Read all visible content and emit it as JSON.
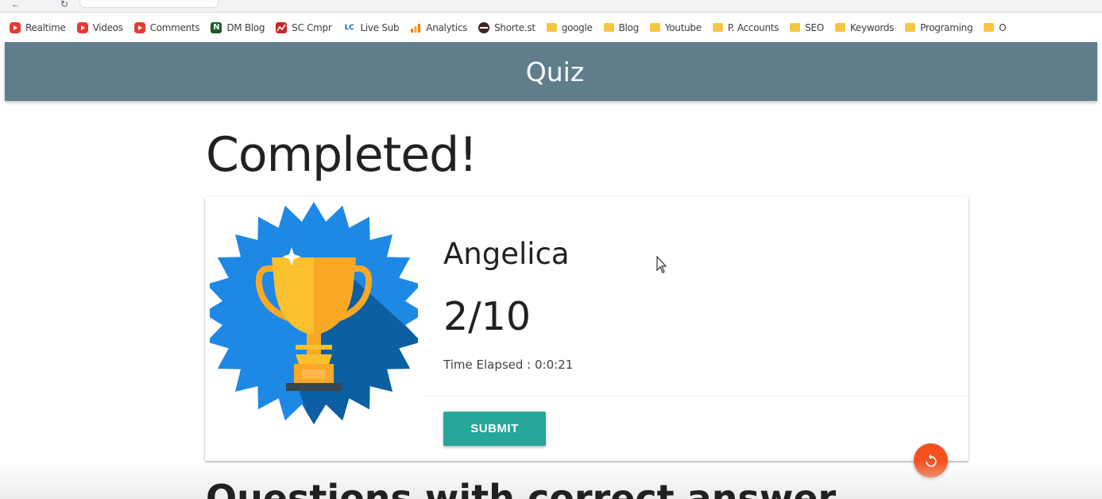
{
  "bookmarks": [
    {
      "label": "Realtime",
      "icon": "youtube-icon"
    },
    {
      "label": "Videos",
      "icon": "youtube-icon"
    },
    {
      "label": "Comments",
      "icon": "youtube-icon"
    },
    {
      "label": "DM Blog",
      "icon": "dm-blog-icon",
      "glyph": "N"
    },
    {
      "label": "SC Cmpr",
      "icon": "sc-icon"
    },
    {
      "label": "Live Sub",
      "icon": "lc-icon",
      "glyph": "LC"
    },
    {
      "label": "Analytics",
      "icon": "analytics-icon"
    },
    {
      "label": "Shorte.st",
      "icon": "shortest-icon"
    },
    {
      "label": "google",
      "icon": "folder-icon"
    },
    {
      "label": "Blog",
      "icon": "folder-icon"
    },
    {
      "label": "Youtube",
      "icon": "folder-icon"
    },
    {
      "label": "P. Accounts",
      "icon": "folder-icon"
    },
    {
      "label": "SEO",
      "icon": "folder-icon"
    },
    {
      "label": "Keywords",
      "icon": "folder-icon"
    },
    {
      "label": "Programing",
      "icon": "folder-icon"
    },
    {
      "label": "O",
      "icon": "folder-icon"
    }
  ],
  "header": {
    "title": "Quiz"
  },
  "result": {
    "heading": "Completed!",
    "name": "Angelica",
    "score": "2/10",
    "time_elapsed": "Time Elapsed : 0:0:21",
    "submit_label": "SUBMIT"
  },
  "next_section": {
    "heading": "Questions with correct answer"
  },
  "colors": {
    "header_bg": "#607d8b",
    "submit_bg": "#26a69a",
    "fab_bg": "#f4511e",
    "badge_light": "#1e88e5",
    "badge_dark": "#0d5fa3",
    "trophy_gold": "#fbc02d"
  }
}
